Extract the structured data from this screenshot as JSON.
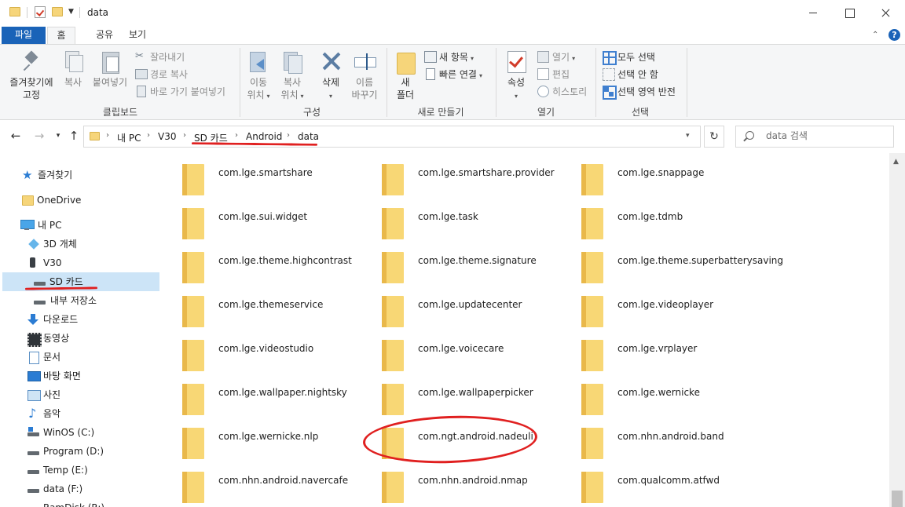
{
  "window": {
    "title": "data"
  },
  "ribbon_tabs": [
    {
      "label": "파일"
    },
    {
      "label": "홈"
    },
    {
      "label": "공유"
    },
    {
      "label": "보기"
    }
  ],
  "ribbon": {
    "clipboard": {
      "pin_label_1": "즐겨찾기에",
      "pin_label_2": "고정",
      "copy_label": "복사",
      "paste_label": "붙여넣기",
      "cut_label": "잘라내기",
      "copy_path_label": "경로 복사",
      "paste_shortcut_label": "바로 가기 붙여넣기",
      "group_label": "클립보드"
    },
    "organize": {
      "move_label_1": "이동",
      "move_label_2": "위치",
      "copyto_label_1": "복사",
      "copyto_label_2": "위치",
      "delete_label": "삭제",
      "rename_label_1": "이름",
      "rename_label_2": "바꾸기",
      "group_label": "구성"
    },
    "new": {
      "newfolder_label_1": "새",
      "newfolder_label_2": "폴더",
      "new_item_label": "새 항목",
      "easy_access_label": "빠른 연결",
      "group_label": "새로 만들기"
    },
    "open": {
      "properties_label": "속성",
      "open_label": "열기",
      "edit_label": "편집",
      "history_label": "히스토리",
      "group_label": "열기"
    },
    "select": {
      "select_all_label": "모두 선택",
      "select_none_label": "선택 안 함",
      "invert_label": "선택 영역 반전",
      "group_label": "선택"
    }
  },
  "address_bar": {
    "crumbs": [
      "내 PC",
      "V30",
      "SD 카드",
      "Android",
      "data"
    ],
    "search_placeholder": "data 검색"
  },
  "sidebar": {
    "items": [
      {
        "label": "즐겨찾기"
      },
      {
        "label": "OneDrive"
      },
      {
        "label": "내 PC"
      },
      {
        "label": "3D 개체"
      },
      {
        "label": "V30"
      },
      {
        "label": "SD 카드"
      },
      {
        "label": "내부 저장소"
      },
      {
        "label": "다운로드"
      },
      {
        "label": "동영상"
      },
      {
        "label": "문서"
      },
      {
        "label": "바탕 화면"
      },
      {
        "label": "사진"
      },
      {
        "label": "음악"
      },
      {
        "label": "WinOS (C:)"
      },
      {
        "label": "Program (D:)"
      },
      {
        "label": "Temp (E:)"
      },
      {
        "label": "data (F:)"
      },
      {
        "label": "RamDisk (R:)"
      }
    ]
  },
  "files": [
    {
      "name": "com.lge.smartshare"
    },
    {
      "name": "com.lge.smartshare.provider"
    },
    {
      "name": "com.lge.snappage"
    },
    {
      "name": "com.lge.sui.widget"
    },
    {
      "name": "com.lge.task"
    },
    {
      "name": "com.lge.tdmb"
    },
    {
      "name": "com.lge.theme.highcontrast"
    },
    {
      "name": "com.lge.theme.signature"
    },
    {
      "name": "com.lge.theme.superbatterysaving"
    },
    {
      "name": "com.lge.themeservice"
    },
    {
      "name": "com.lge.updatecenter"
    },
    {
      "name": "com.lge.videoplayer"
    },
    {
      "name": "com.lge.videostudio"
    },
    {
      "name": "com.lge.voicecare"
    },
    {
      "name": "com.lge.vrplayer"
    },
    {
      "name": "com.lge.wallpaper.nightsky"
    },
    {
      "name": "com.lge.wallpaperpicker"
    },
    {
      "name": "com.lge.wernicke"
    },
    {
      "name": "com.lge.wernicke.nlp"
    },
    {
      "name": "com.ngt.android.nadeuli"
    },
    {
      "name": "com.nhn.android.band"
    },
    {
      "name": "com.nhn.android.navercafe"
    },
    {
      "name": "com.nhn.android.nmap"
    },
    {
      "name": "com.qualcomm.atfwd"
    }
  ],
  "colors": {
    "accent": "#1a63b8",
    "selection": "#cce4f7",
    "annotation": "#e02020",
    "folder": "#f8d775"
  }
}
